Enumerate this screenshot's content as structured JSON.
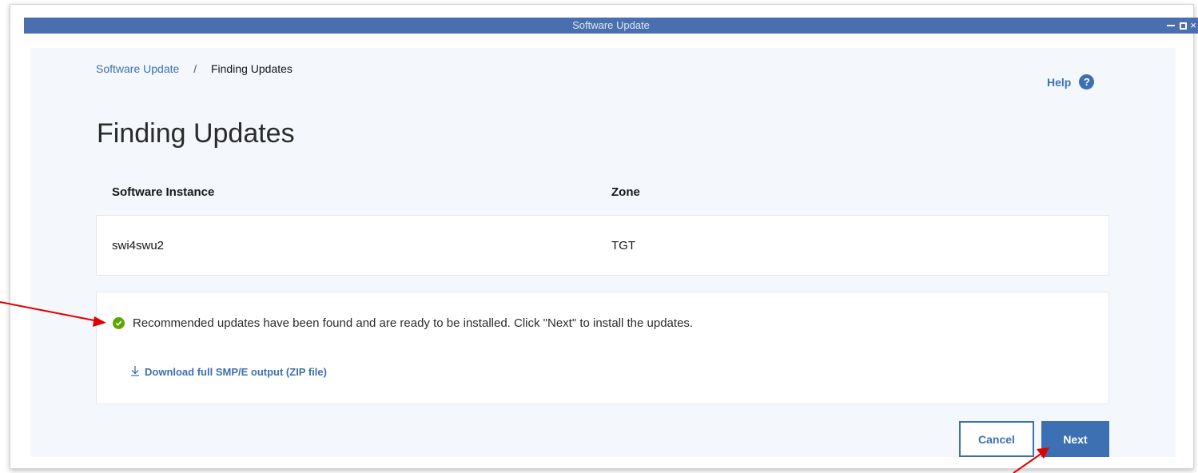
{
  "window": {
    "title": "Software Update",
    "close_glyph": "×"
  },
  "breadcrumb": {
    "parent": "Software Update",
    "separator": "/",
    "current": "Finding Updates"
  },
  "help": {
    "label": "Help",
    "icon": "question-circle-icon",
    "glyph": "?"
  },
  "page": {
    "title": "Finding Updates"
  },
  "table": {
    "headers": [
      "Software Instance",
      "Zone"
    ],
    "rows": [
      {
        "instance": "swi4swu2",
        "zone": "TGT"
      }
    ]
  },
  "status": {
    "icon": "checkmark-circle-icon",
    "message": "Recommended updates have been found and are ready to be installed. Click \"Next\" to install the updates.",
    "download_link": "Download full SMP/E output (ZIP file)"
  },
  "actions": {
    "cancel_label": "Cancel",
    "next_label": "Next"
  },
  "colors": {
    "titlebar": "#4a6fae",
    "accent": "#3d70b2",
    "success": "#5aa700",
    "annotation_arrow": "#e00000"
  }
}
